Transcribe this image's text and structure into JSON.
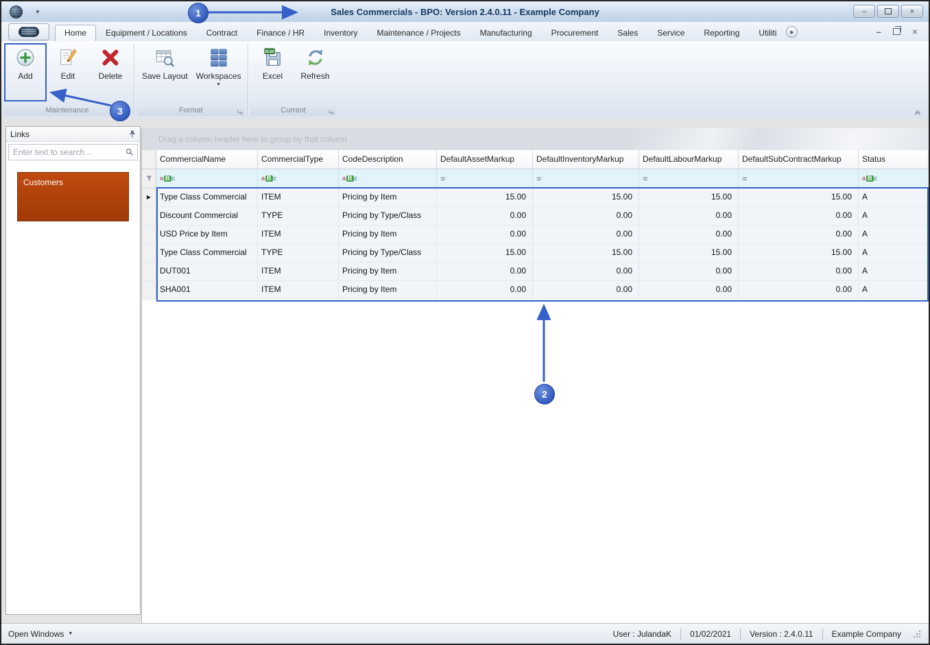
{
  "window": {
    "title": "Sales Commercials - BPO: Version 2.4.0.11 - Example Company"
  },
  "ribbon": {
    "active_tab": "Home",
    "tabs": [
      "Home",
      "Equipment / Locations",
      "Contract",
      "Finance / HR",
      "Inventory",
      "Maintenance / Projects",
      "Manufacturing",
      "Procurement",
      "Sales",
      "Service",
      "Reporting",
      "Utiliti"
    ],
    "groups": [
      {
        "label": "Maintenance",
        "buttons": [
          {
            "label": "Add",
            "icon": "add-icon"
          },
          {
            "label": "Edit",
            "icon": "edit-icon"
          },
          {
            "label": "Delete",
            "icon": "delete-icon"
          }
        ]
      },
      {
        "label": "Format",
        "buttons": [
          {
            "label": "Save Layout",
            "icon": "save-layout-icon"
          },
          {
            "label": "Workspaces",
            "icon": "workspaces-icon",
            "has_dropdown": true
          }
        ]
      },
      {
        "label": "Current",
        "buttons": [
          {
            "label": "Excel",
            "icon": "excel-icon"
          },
          {
            "label": "Refresh",
            "icon": "refresh-icon"
          }
        ]
      }
    ]
  },
  "sidebar": {
    "title": "Links",
    "search_placeholder": "Enter text to search...",
    "links": [
      {
        "label": "Customers"
      }
    ]
  },
  "grid": {
    "group_hint": "Drag a column header here to group by that column",
    "columns": [
      "CommercialName",
      "CommercialType",
      "CodeDescription",
      "DefaultAssetMarkup",
      "DefaultInventoryMarkup",
      "DefaultLabourMarkup",
      "DefaultSubContractMarkup",
      "Status"
    ],
    "filter_row": [
      "aBc",
      "aBc",
      "aBc",
      "=",
      "=",
      "=",
      "=",
      "aBc"
    ],
    "rows": [
      [
        "Type Class Commercial",
        "ITEM",
        "Pricing by Item",
        "15.00",
        "15.00",
        "15.00",
        "15.00",
        "A"
      ],
      [
        "Discount Commercial",
        "TYPE",
        "Pricing by Type/Class",
        "0.00",
        "0.00",
        "0.00",
        "0.00",
        "A"
      ],
      [
        "USD Price by Item",
        "ITEM",
        "Pricing by Item",
        "0.00",
        "0.00",
        "0.00",
        "0.00",
        "A"
      ],
      [
        "Type Class Commercial",
        "TYPE",
        "Pricing by Type/Class",
        "15.00",
        "15.00",
        "15.00",
        "15.00",
        "A"
      ],
      [
        "DUT001",
        "ITEM",
        "Pricing by Item",
        "0.00",
        "0.00",
        "0.00",
        "0.00",
        "A"
      ],
      [
        "SHA001",
        "ITEM",
        "Pricing by Item",
        "0.00",
        "0.00",
        "0.00",
        "0.00",
        "A"
      ]
    ]
  },
  "statusbar": {
    "open_windows": "Open Windows",
    "user": "User : JulandaK",
    "date": "01/02/2021",
    "version": "Version : 2.4.0.11",
    "company": "Example Company"
  },
  "annotations": {
    "accent_color": "#3661c9",
    "callouts": [
      {
        "number": "1"
      },
      {
        "number": "2"
      },
      {
        "number": "3"
      }
    ]
  },
  "colors": {
    "annotation_blue": "#3661c9",
    "customers_tile": "#b5420c"
  }
}
